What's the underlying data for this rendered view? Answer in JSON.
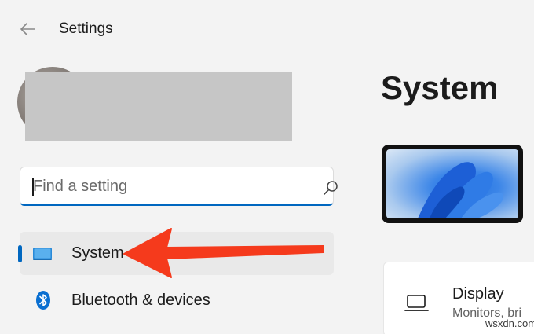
{
  "window": {
    "title": "Settings",
    "back_icon": "back-arrow-icon"
  },
  "search": {
    "placeholder": "Find a setting",
    "value": "",
    "icon": "search-icon"
  },
  "sidebar": {
    "items": [
      {
        "label": "System",
        "icon": "display-monitor-icon",
        "selected": true
      },
      {
        "label": "Bluetooth & devices",
        "icon": "bluetooth-icon",
        "selected": false
      }
    ]
  },
  "main": {
    "title": "System",
    "cards": [
      {
        "title": "Display",
        "subtitle": "Monitors, bri",
        "icon": "display-icon"
      }
    ]
  },
  "annotation": {
    "type": "red-arrow",
    "color": "#f53a1c"
  },
  "watermark": {
    "text": "wsxdn.com"
  },
  "colors": {
    "accent": "#0067c0",
    "background": "#f3f3f3",
    "selected_item": "#e9e9e9"
  }
}
